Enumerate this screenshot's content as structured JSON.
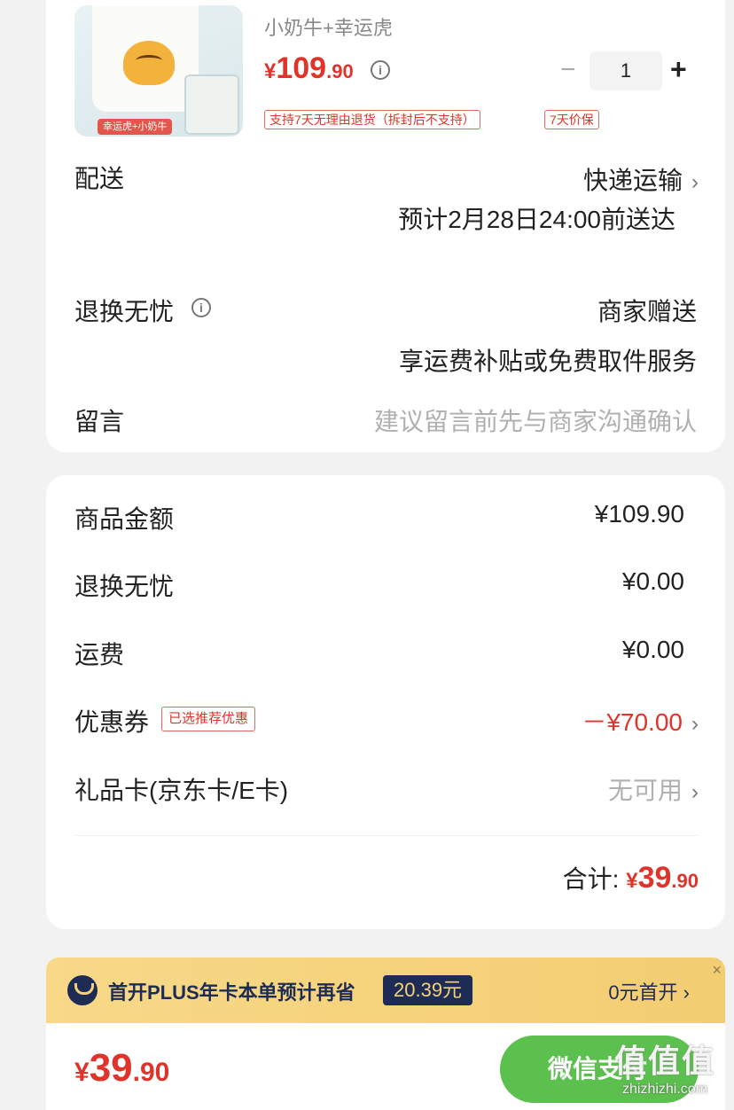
{
  "product": {
    "image_tag": "幸运虎+小奶牛",
    "spec": "小奶牛+幸运虎",
    "price_symbol": "¥",
    "price_int": "109",
    "price_dec": ".90",
    "quantity": "1",
    "tags": [
      "支持7天无理由退货（拆封后不支持）",
      "7天价保"
    ]
  },
  "delivery": {
    "label": "配送",
    "method": "快递运输",
    "eta": "预计2月28日24:00前送达"
  },
  "return_service": {
    "label": "退换无忧",
    "value": "商家赠送",
    "sub": "享运费补贴或免费取件服务"
  },
  "message": {
    "label": "留言",
    "placeholder": "建议留言前先与商家沟通确认"
  },
  "summary": {
    "items": [
      {
        "label": "商品金额",
        "value": "¥109.90"
      },
      {
        "label": "退换无忧",
        "value": "¥0.00"
      },
      {
        "label": "运费",
        "value": "¥0.00"
      },
      {
        "label": "优惠券",
        "badge": "已选推荐优惠",
        "value": "－¥70.00"
      },
      {
        "label": "礼品卡(京东卡/E卡)",
        "value": "无可用"
      }
    ],
    "total_label": "合计:",
    "total_symbol": "¥",
    "total_int": "39",
    "total_dec": ".90"
  },
  "plus_banner": {
    "text": "首开PLUS年卡本单预计再省",
    "saving": "20.39元",
    "cta": "0元首开 ›",
    "close": "×"
  },
  "bottom": {
    "price_symbol": "¥",
    "price_int": "39",
    "price_dec": ".90",
    "pay_label": "微信支付"
  },
  "watermark": {
    "text": "值值值",
    "site": "zhizhizhi.com"
  }
}
